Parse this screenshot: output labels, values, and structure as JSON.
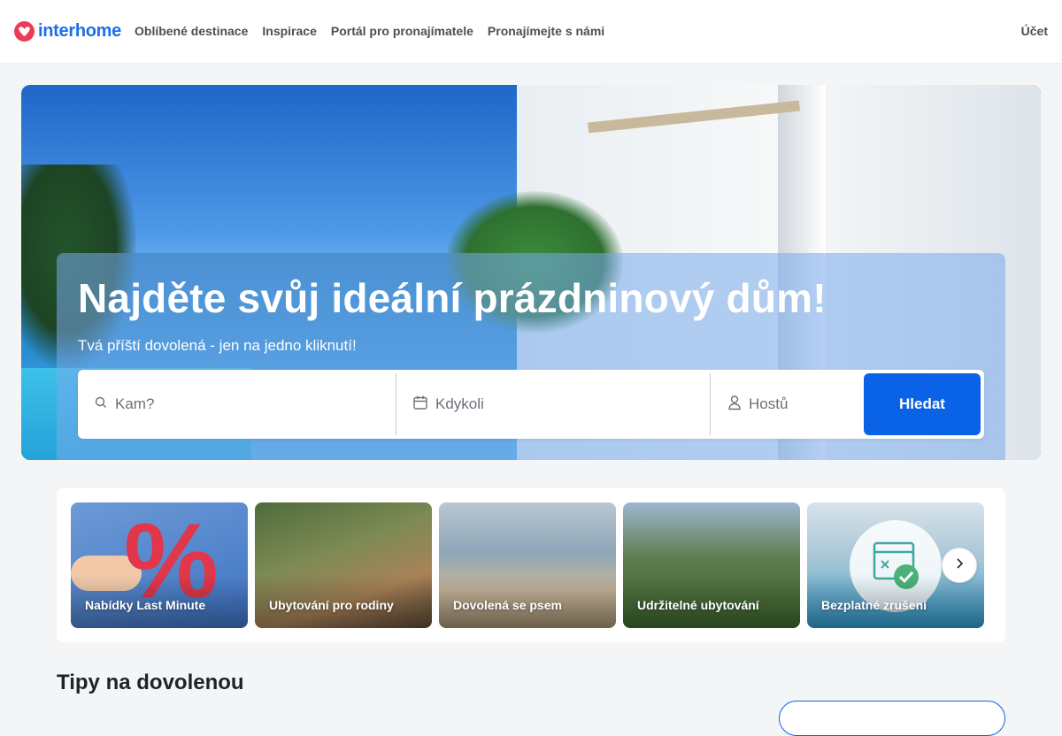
{
  "header": {
    "logo_text": "interhome",
    "nav": [
      {
        "label": "Oblíbené destinace"
      },
      {
        "label": "Inspirace"
      },
      {
        "label": "Portál pro pronajímatele"
      },
      {
        "label": "Pronajímejte s námi"
      }
    ],
    "account_label": "Účet"
  },
  "hero": {
    "title": "Najděte svůj ideální prázdninový dům!",
    "subtitle": "Tvá příští dovolená - jen na jedno kliknutí!",
    "search": {
      "where_placeholder": "Kam?",
      "when_placeholder": "Kdykoli",
      "guests_placeholder": "Hostů",
      "button_label": "Hledat"
    }
  },
  "categories": [
    {
      "label": "Nabídky Last Minute"
    },
    {
      "label": "Ubytování pro rodiny"
    },
    {
      "label": "Dovolená se psem"
    },
    {
      "label": "Udržitelné ubytování"
    },
    {
      "label": "Bezplatné zrušení"
    }
  ],
  "tips": {
    "title": "Tipy na dovolenou"
  },
  "colors": {
    "brand_blue": "#0a63e6",
    "logo_red": "#ee3a56"
  }
}
